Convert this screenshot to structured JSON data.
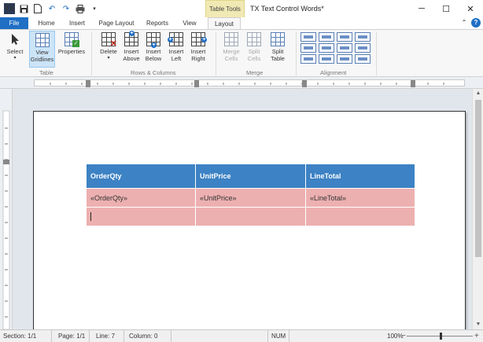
{
  "titlebar": {
    "title": "TX Text Control Words*",
    "context_tab": "Table Tools",
    "app_icon_text": "TX",
    "qat_icons": [
      "save-icon",
      "new-document-icon",
      "undo-icon",
      "redo-icon",
      "print-icon",
      "customize-qat-icon"
    ]
  },
  "tabs": [
    {
      "label": "File"
    },
    {
      "label": "Home"
    },
    {
      "label": "Insert"
    },
    {
      "label": "Page Layout"
    },
    {
      "label": "Reports"
    },
    {
      "label": "View"
    },
    {
      "label": "Layout",
      "active": true
    }
  ],
  "ribbon": {
    "table": {
      "group_label": "Table",
      "select": "Select",
      "view_gridlines": [
        "View",
        "Gridlines"
      ],
      "properties": "Properties"
    },
    "rows_columns": {
      "group_label": "Rows & Columns",
      "delete": "Delete",
      "insert_above": [
        "Insert",
        "Above"
      ],
      "insert_below": [
        "Insert",
        "Below"
      ],
      "insert_left": [
        "Insert",
        "Left"
      ],
      "insert_right": [
        "Insert",
        "Right"
      ]
    },
    "merge": {
      "group_label": "Merge",
      "merge_cells": [
        "Merge",
        "Cells"
      ],
      "split_cells": [
        "Split",
        "Cells"
      ],
      "split_table": [
        "Split",
        "Table"
      ]
    },
    "alignment": {
      "group_label": "Alignment"
    }
  },
  "document": {
    "table": {
      "headers": [
        "OrderQty",
        "UnitPrice",
        "LineTotal"
      ],
      "rows": [
        [
          "«OrderQty»",
          "«UnitPrice»",
          "«LineTotal»"
        ],
        [
          "",
          "",
          ""
        ]
      ]
    }
  },
  "status": {
    "section": "Section: 1/1",
    "page": "Page: 1/1",
    "line": "Line: 7",
    "column": "Column: 0",
    "num": "NUM",
    "zoom": "100%"
  },
  "colors": {
    "accent": "#1f6fc5",
    "table_header": "#3c82c4",
    "table_body": "#edb0b0",
    "context_tab": "#f1e9b4"
  }
}
